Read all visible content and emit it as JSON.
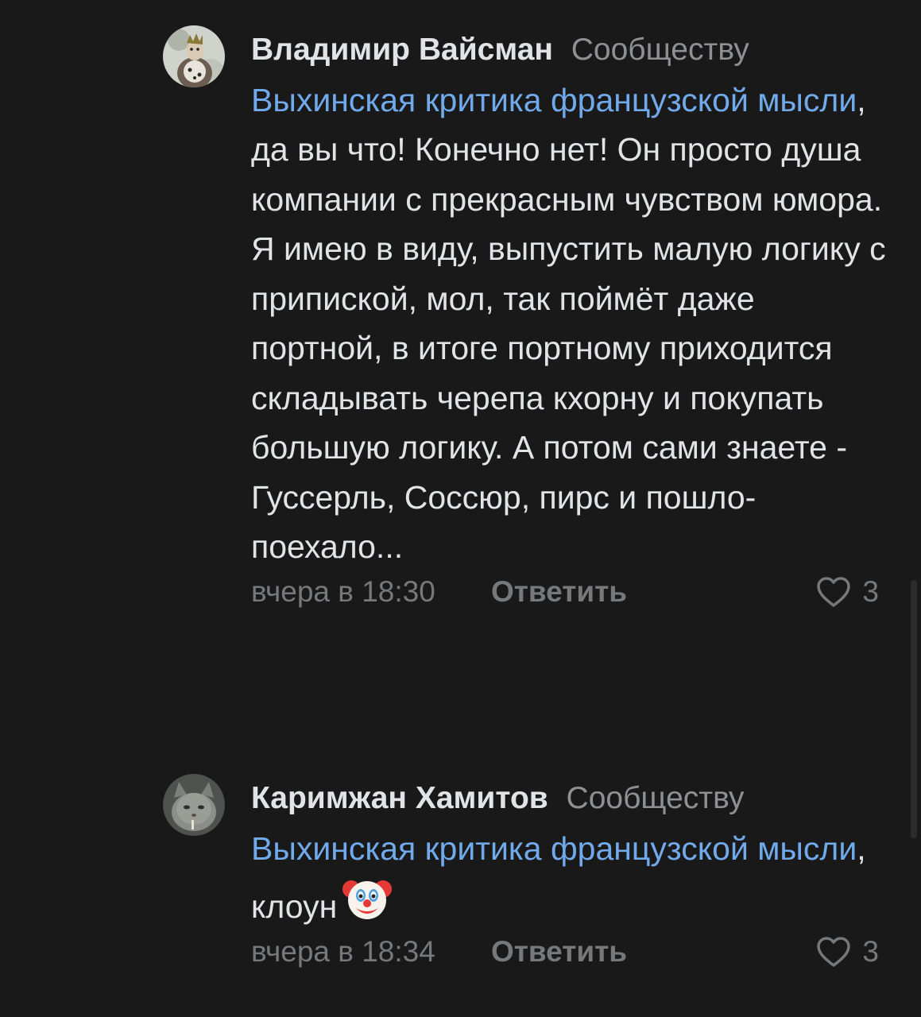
{
  "comments": [
    {
      "author": "Владимир Вайсман",
      "to_label": "Сообществу",
      "mention": "Выхинская критика французской мысли",
      "text": ", да вы что! Конечно нет! Он просто душа компании с прекрасным чувством юмора. Я имею в виду, выпустить малую логику с припиской, мол, так поймёт даже портной, в итоге портному приходится складывать черепа кхорну и покупать большую логику. А потом сами знаете - Гуссерль, Соссюр, пирс и пошло-поехало...",
      "time": "вчера в 18:30",
      "reply_label": "Ответить",
      "likes": "3",
      "avatar_icon": "avatar-figure"
    },
    {
      "author": "Каримжан Хамитов",
      "to_label": "Сообществу",
      "mention": "Выхинская критика французской мысли",
      "text": ", клоун",
      "emoji": "clown-face-emoji",
      "time": "вчера в 18:34",
      "reply_label": "Ответить",
      "likes": "3",
      "avatar_icon": "avatar-cat"
    }
  ],
  "colors": {
    "background": "#19191a",
    "text": "#e1e3e6",
    "link": "#71aaeb",
    "secondary": "#8d9094"
  }
}
